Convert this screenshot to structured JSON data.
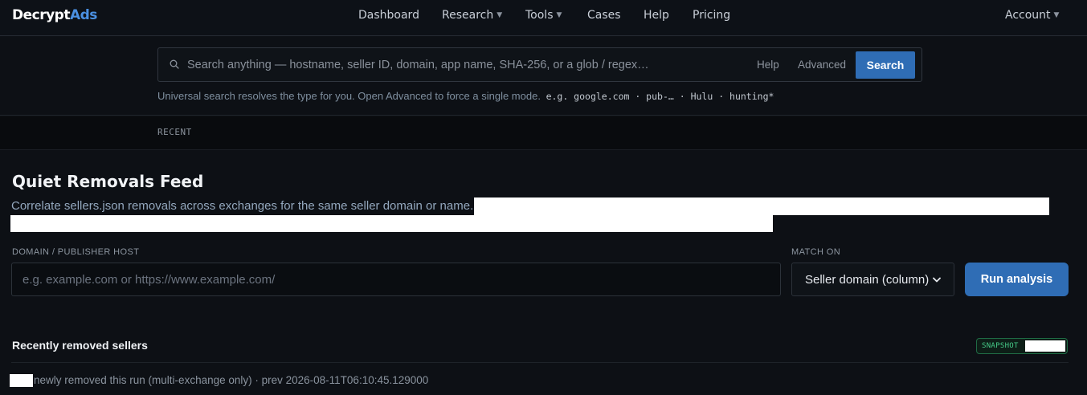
{
  "brand": {
    "name_part1": "Decrypt",
    "name_part2": "Ads",
    "accent_color": "#4a90e2"
  },
  "nav": {
    "items": [
      {
        "label": "Dashboard",
        "has_caret": false
      },
      {
        "label": "Research",
        "has_caret": true
      },
      {
        "label": "Tools",
        "has_caret": true
      },
      {
        "label": "Cases",
        "has_caret": false
      },
      {
        "label": "Help",
        "has_caret": false
      },
      {
        "label": "Pricing",
        "has_caret": false
      }
    ],
    "account_label": "Account"
  },
  "search": {
    "placeholder": "Search anything — hostname, seller ID, domain, app name, SHA-256, or a glob / regex…",
    "value": "",
    "help_label": "Help",
    "advanced_label": "Advanced",
    "button_label": "Search",
    "hint_text": "Universal search resolves the type for you. Open Advanced to force a single mode.",
    "hint_examples": "e.g. google.com · pub-… · Hulu · hunting*"
  },
  "recent": {
    "label": "RECENT"
  },
  "main": {
    "title": "Quiet Removals Feed",
    "description": "Correlate sellers.json removals across exchanges for the same seller domain or name.",
    "domain_field": {
      "label": "DOMAIN / PUBLISHER HOST",
      "placeholder": "e.g. example.com or https://www.example.com/",
      "value": ""
    },
    "match_field": {
      "label": "MATCH ON",
      "selected": "Seller domain (column)"
    },
    "run_button_label": "Run analysis",
    "results": {
      "title": "Recently removed sellers",
      "snapshot_badge": "SNAPSHOT",
      "status_text": "newly removed this run (multi-exchange only) · prev 2026-08-11T06:10:45.129000"
    }
  },
  "colors": {
    "primary_button": "#2f6db5",
    "page_bg": "#0d1015",
    "badge_green": "#45c987"
  }
}
